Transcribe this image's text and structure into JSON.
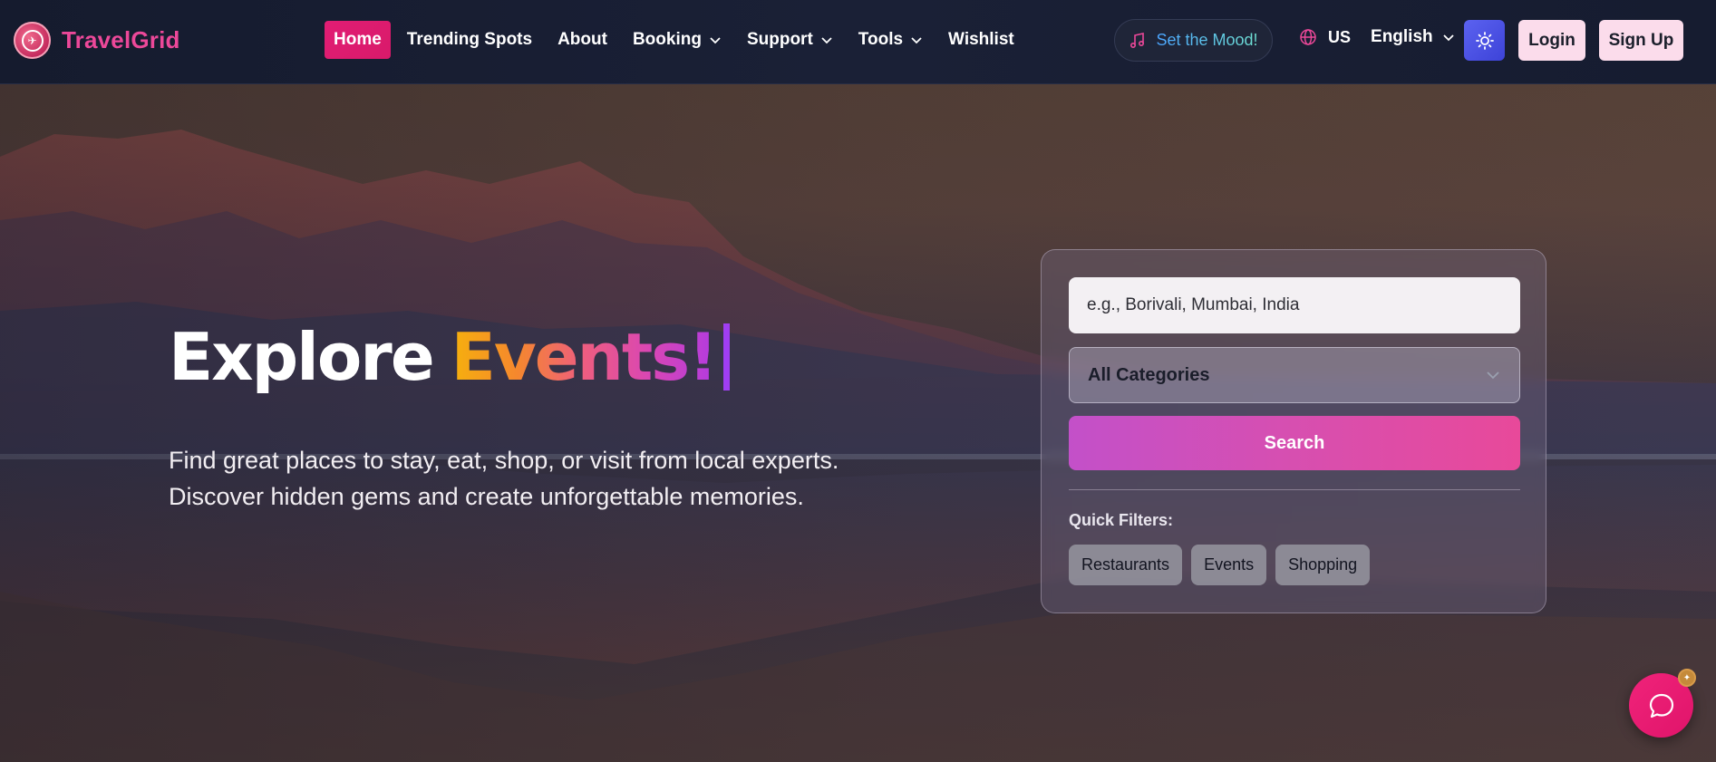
{
  "brand": {
    "name": "TravelGrid",
    "logo_icon": "plane-icon"
  },
  "nav": {
    "items": [
      {
        "label": "Home",
        "active": true,
        "dropdown": false
      },
      {
        "label": "Trending Spots",
        "active": false,
        "dropdown": false
      },
      {
        "label": "About",
        "active": false,
        "dropdown": false
      },
      {
        "label": "Booking",
        "active": false,
        "dropdown": true
      },
      {
        "label": "Support",
        "active": false,
        "dropdown": true
      },
      {
        "label": "Tools",
        "active": false,
        "dropdown": true
      },
      {
        "label": "Wishlist",
        "active": false,
        "dropdown": false
      }
    ]
  },
  "header": {
    "mood_label": "Set the Mood!",
    "mood_icon": "music-note-icon",
    "language_code": "US",
    "language_name": "English",
    "theme_icon": "sun-icon",
    "login_label": "Login",
    "signup_label": "Sign Up"
  },
  "hero": {
    "headline_prefix": "Explore",
    "headline_highlight": "Events!",
    "subtext_line1": "Find great places to stay, eat, shop, or visit from local experts.",
    "subtext_line2": "Discover hidden gems and create unforgettable memories."
  },
  "search": {
    "placeholder": "e.g., Borivali, Mumbai, India",
    "value": "",
    "category_selected": "All Categories",
    "search_label": "Search",
    "quick_filters_label": "Quick Filters:",
    "quick_filters": [
      "Restaurants",
      "Events",
      "Shopping"
    ]
  },
  "colors": {
    "brand_pink": "#ec4899",
    "nav_active": "#e11d74",
    "theme_button": "#4f56e8",
    "button_light": "#fbdceb",
    "search_button": "#d74fb0",
    "cursor": "#a03ef2"
  },
  "chat": {
    "icon": "chat-bubble-icon"
  }
}
